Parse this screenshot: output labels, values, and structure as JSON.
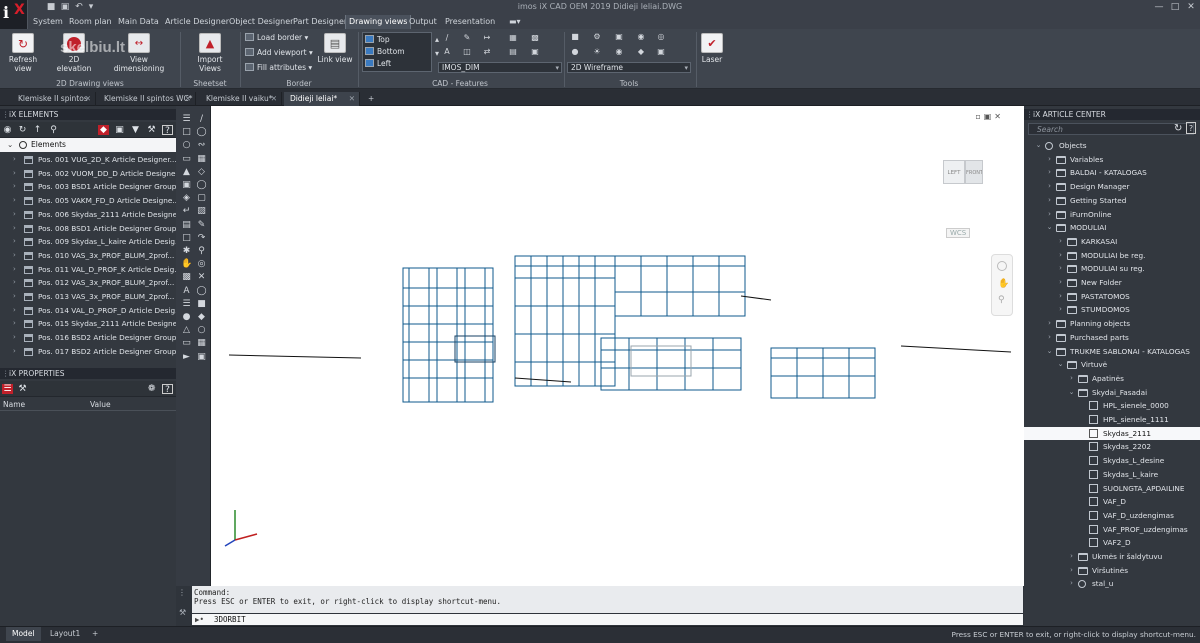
{
  "app": {
    "title": "imos iX CAD OEM 2019   Didieji leliai.DWG"
  },
  "menu": {
    "tabs": [
      "System",
      "Room plan",
      "Main Data",
      "Article Designer",
      "Object Designer",
      "Part Designer",
      "Drawing views",
      "Output",
      "Presentation"
    ],
    "active": "Drawing views"
  },
  "ribbon": {
    "buttons": {
      "refresh_view": "Refresh view",
      "elevation": "2D elevation",
      "view_dimensioning": "View dimensioning",
      "import_views": "Import Views",
      "link_view": "Link view",
      "laser": "Laser"
    },
    "border": {
      "load_border": "Load border",
      "add_viewport": "Add viewport",
      "fill_attributes": "Fill attributes"
    },
    "views": [
      "Top",
      "Bottom",
      "Left"
    ],
    "combos": {
      "dim_style": "IMOS_DIM",
      "visual_style": "2D Wireframe"
    },
    "groups": {
      "drawing_views": "2D Drawing views",
      "sheetset": "Sheetset",
      "border": "Border",
      "cad_features": "CAD - Features",
      "tools": "Tools"
    },
    "watermark": "skelbiu.lt"
  },
  "doc_tabs": [
    {
      "label": "Klemiske II spintos",
      "active": false
    },
    {
      "label": "Klemiske II spintos WC*",
      "active": false
    },
    {
      "label": "Klemiske II vaiku*",
      "active": false
    },
    {
      "label": "Didieji leliai*",
      "active": true
    }
  ],
  "elements_panel": {
    "header": "iX ELEMENTS",
    "root": "Elements",
    "items": [
      "Pos. 001 VUG_2D_K Article Designer...",
      "Pos. 002 VUOM_DD_D Article Designe...",
      "Pos. 003 BSD1 Article Designer Group",
      "Pos. 005 VAKM_FD_D Article Designe...",
      "Pos. 006 Skydas_2111 Article Designe...",
      "Pos. 008 BSD1 Article Designer Group",
      "Pos. 009 Skydas_L_kaire Article Desig...",
      "Pos. 010 VAS_3x_PROF_BLUM_2prof...",
      "Pos. 011 VAL_D_PROF_K Article Desig...",
      "Pos. 012 VAS_3x_PROF_BLUM_2prof...",
      "Pos. 013 VAS_3x_PROF_BLUM_2prof...",
      "Pos. 014 VAL_D_PROF_D Article Desig...",
      "Pos. 015 Skydas_2111 Article Designe...",
      "Pos. 016 BSD2 Article Designer Group",
      "Pos. 017 BSD2 Article Designer Group"
    ]
  },
  "properties_panel": {
    "header": "iX PROPERTIES",
    "col_name": "Name",
    "col_value": "Value"
  },
  "viewport": {
    "cube_left": "LEFT",
    "cube_front": "FRONT",
    "wcs": "WCS"
  },
  "command": {
    "history_1": "Command:",
    "history_2": "Press ESC or ENTER to exit, or right-click to display shortcut-menu.",
    "current": "3DORBIT"
  },
  "article_center": {
    "header": "iX ARTICLE CENTER",
    "search_placeholder": "Search",
    "tree": [
      {
        "label": "Objects",
        "level": 0,
        "icon": "root",
        "expand": "v"
      },
      {
        "label": "Variables",
        "level": 1,
        "icon": "folder",
        "expand": ">"
      },
      {
        "label": "BALDAI - KATALOGAS",
        "level": 1,
        "icon": "folder",
        "expand": ">"
      },
      {
        "label": "Design Manager",
        "level": 1,
        "icon": "folder",
        "expand": ">"
      },
      {
        "label": "Getting Started",
        "level": 1,
        "icon": "folder",
        "expand": ">"
      },
      {
        "label": "iFurnOnline",
        "level": 1,
        "icon": "folder",
        "expand": ">"
      },
      {
        "label": "MODULIAI",
        "level": 1,
        "icon": "folder",
        "expand": "v"
      },
      {
        "label": "KARKASAI",
        "level": 2,
        "icon": "folder",
        "expand": ">"
      },
      {
        "label": "MODULIAI be reg.",
        "level": 2,
        "icon": "folder",
        "expand": ">"
      },
      {
        "label": "MODULIAI su reg.",
        "level": 2,
        "icon": "folder",
        "expand": ">"
      },
      {
        "label": "New Folder",
        "level": 2,
        "icon": "folder",
        "expand": ">"
      },
      {
        "label": "PASTATOMOS",
        "level": 2,
        "icon": "folder",
        "expand": ">"
      },
      {
        "label": "STUMDOMOS",
        "level": 2,
        "icon": "folder",
        "expand": ">"
      },
      {
        "label": "Planning objects",
        "level": 1,
        "icon": "folder",
        "expand": ">"
      },
      {
        "label": "Purchased parts",
        "level": 1,
        "icon": "folder",
        "expand": ">"
      },
      {
        "label": "TRUKME SABLONAI - KATALOGAS",
        "level": 1,
        "icon": "folder",
        "expand": "v"
      },
      {
        "label": "Virtuvė",
        "level": 2,
        "icon": "folder",
        "expand": "v"
      },
      {
        "label": "Apatinės",
        "level": 3,
        "icon": "folder",
        "expand": ">"
      },
      {
        "label": "Skydai_Fasadai",
        "level": 3,
        "icon": "folder",
        "expand": "v"
      },
      {
        "label": "HPL_sienele_0000",
        "level": 4,
        "icon": "obj",
        "expand": ""
      },
      {
        "label": "HPL_sienele_1111",
        "level": 4,
        "icon": "obj",
        "expand": ""
      },
      {
        "label": "Skydas_2111",
        "level": 4,
        "icon": "obj",
        "expand": "",
        "selected": true
      },
      {
        "label": "Skydas_2202",
        "level": 4,
        "icon": "obj",
        "expand": ""
      },
      {
        "label": "Skydas_L_desine",
        "level": 4,
        "icon": "obj",
        "expand": ""
      },
      {
        "label": "Skydas_L_kaire",
        "level": 4,
        "icon": "obj",
        "expand": ""
      },
      {
        "label": "SUOLNGTA_APDAILINE",
        "level": 4,
        "icon": "obj",
        "expand": ""
      },
      {
        "label": "VAF_D",
        "level": 4,
        "icon": "obj",
        "expand": ""
      },
      {
        "label": "VAF_D_uzdengimas",
        "level": 4,
        "icon": "obj",
        "expand": ""
      },
      {
        "label": "VAF_PROF_uzdengimas",
        "level": 4,
        "icon": "obj",
        "expand": ""
      },
      {
        "label": "VAF2_D",
        "level": 4,
        "icon": "obj",
        "expand": ""
      },
      {
        "label": "Ukmės ir šaldytuvu",
        "level": 3,
        "icon": "folder",
        "expand": ">"
      },
      {
        "label": "Viršutinės",
        "level": 3,
        "icon": "folder",
        "expand": ">"
      },
      {
        "label": "stal_u",
        "level": 3,
        "icon": "root",
        "expand": ">"
      }
    ]
  },
  "status": {
    "tabs": [
      "Model",
      "Layout1"
    ],
    "message": "Press ESC or ENTER to exit, or right-click to display shortcut-menu."
  },
  "colors": {
    "accent": "#1e6fa8",
    "wire": "#0f5a8c",
    "panel_bg": "#33383f",
    "selected_row": "#f7f8fa"
  }
}
